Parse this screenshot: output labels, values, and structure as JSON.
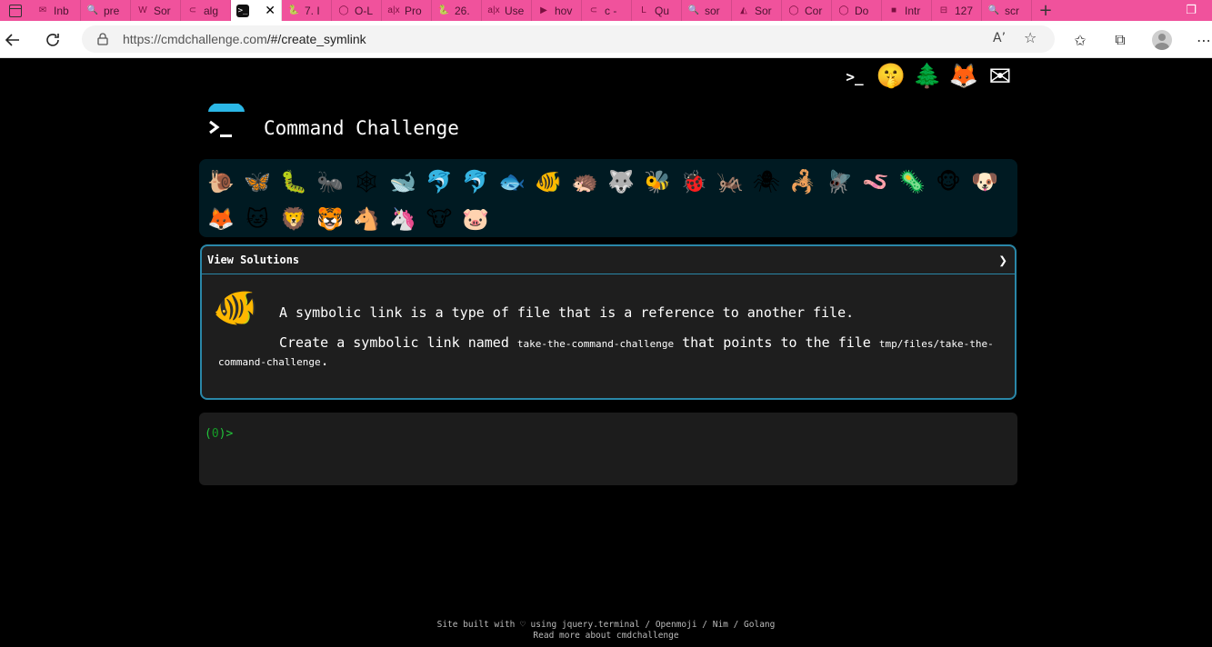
{
  "browser": {
    "tabs": [
      {
        "icon": "✉",
        "label": "Inb"
      },
      {
        "icon": "🔍",
        "label": "pre"
      },
      {
        "icon": "W",
        "label": "Sor"
      },
      {
        "icon": "⊂",
        "label": "alg"
      },
      {
        "icon": ">_",
        "label": "",
        "active": true
      },
      {
        "icon": "🐍",
        "label": "7. I"
      },
      {
        "icon": "◯",
        "label": "O-L"
      },
      {
        "icon": "a|x",
        "label": "Pro"
      },
      {
        "icon": "🐍",
        "label": "26."
      },
      {
        "icon": "a|x",
        "label": "Use"
      },
      {
        "icon": "▶",
        "label": "hov"
      },
      {
        "icon": "⊂",
        "label": "c -"
      },
      {
        "icon": "L",
        "label": "Qu"
      },
      {
        "icon": "🔍",
        "label": "sor"
      },
      {
        "icon": "◭",
        "label": "Sor"
      },
      {
        "icon": "◯",
        "label": "Cor"
      },
      {
        "icon": "◯",
        "label": "Do"
      },
      {
        "icon": "■",
        "label": "Intr"
      },
      {
        "icon": "⊟",
        "label": "127"
      },
      {
        "icon": "🔍",
        "label": "scr"
      }
    ],
    "url_prefix": "https://cmdchallenge.com",
    "url_path": "/#/create_symlink",
    "read_aloud": "A’",
    "newtab": "+"
  },
  "page": {
    "header_icons": [
      {
        "name": "terminal-logo-icon",
        "glyph": ">_"
      },
      {
        "name": "shushing-face-icon",
        "glyph": "🤫"
      },
      {
        "name": "evergreen-tree-icon",
        "glyph": "🌲"
      },
      {
        "name": "gitlab-icon",
        "glyph": "🦊"
      },
      {
        "name": "envelope-icon",
        "glyph": "✉"
      }
    ],
    "title": "Command Challenge",
    "animals": [
      "🐌",
      "🦋",
      "🐛",
      "🐜",
      "🕸",
      "🐋",
      "🐬",
      "🐬",
      "🐟",
      "🐠",
      "🦔",
      "🐺",
      "🐝",
      "🐞",
      "🦗",
      "🕷",
      "🦂",
      "🪰",
      "🪱",
      "🦠",
      "🐵",
      "🐶",
      "🦊",
      "🐱",
      "🦁",
      "🐯",
      "🐴",
      "🦄",
      "🐮",
      "🐷"
    ],
    "panel": {
      "heading": "View Solutions",
      "chevron": "❯",
      "fish": "🐠",
      "intro": "A symbolic link is a type of file that is a reference to another file.",
      "task_pre": "Create a symbolic link named ",
      "task_link": "take-the-command-challenge",
      "task_mid": " that points to the file ",
      "task_target": "tmp/files/take-the-command-challenge",
      "task_end": "."
    },
    "terminal": {
      "prompt_open": "(",
      "prompt_count": "0",
      "prompt_close": ")>"
    },
    "footer": {
      "line1": "Site built with ♡ using jquery.terminal / Openmoji / Nim / Golang",
      "line2": "Read more about cmdchallenge"
    }
  }
}
